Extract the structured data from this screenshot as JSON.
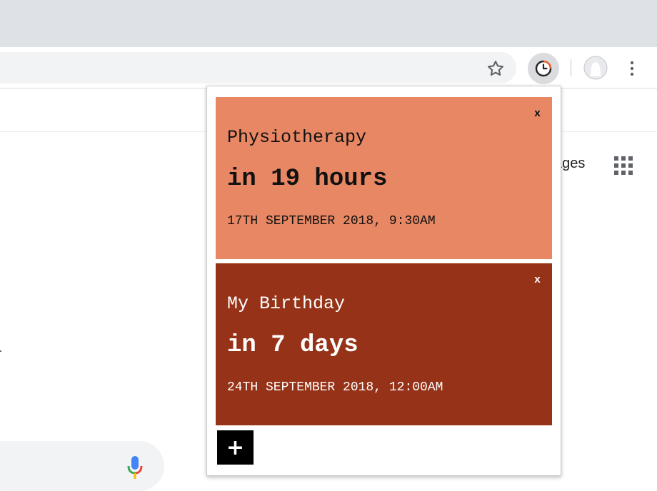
{
  "browser": {
    "toolbar": {
      "star_icon": "star-icon",
      "extension_icon": "clock-icon",
      "avatar_icon": "profile-avatar-icon",
      "menu_icon": "more-vert-icon"
    }
  },
  "page": {
    "images_link": "ages",
    "apps_icon": "apps-grid-icon",
    "mic_icon": "microphone-icon"
  },
  "popup": {
    "cards": [
      {
        "title": "Physiotherapy",
        "relative": "in 19 hours",
        "date": "17TH SEPTEMBER 2018, 9:30AM",
        "close_label": "x",
        "color": "#e88763"
      },
      {
        "title": "My Birthday",
        "relative": "in 7 days",
        "date": "24TH SEPTEMBER 2018, 12:00AM",
        "close_label": "x",
        "color": "#963217"
      }
    ],
    "add_label": "+"
  }
}
